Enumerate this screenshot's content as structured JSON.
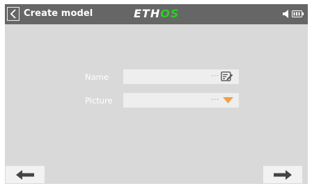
{
  "header": {
    "title": "Create model",
    "logo_main": "ETH",
    "logo_accent": "OS",
    "icons": [
      "chevron-left-icon",
      "speaker-icon",
      "battery-icon"
    ]
  },
  "form": {
    "name_label": "Name",
    "name_value": "---",
    "picture_label": "Picture",
    "picture_value": "---"
  },
  "navigation": {
    "previous_icon": "arrow-left-icon",
    "next_icon": "arrow-right-icon"
  },
  "colors": {
    "topbar": "#666666",
    "panel": "#d9d9d9",
    "accent_green": "#2ad024",
    "accent_orange": "#f0a048"
  }
}
